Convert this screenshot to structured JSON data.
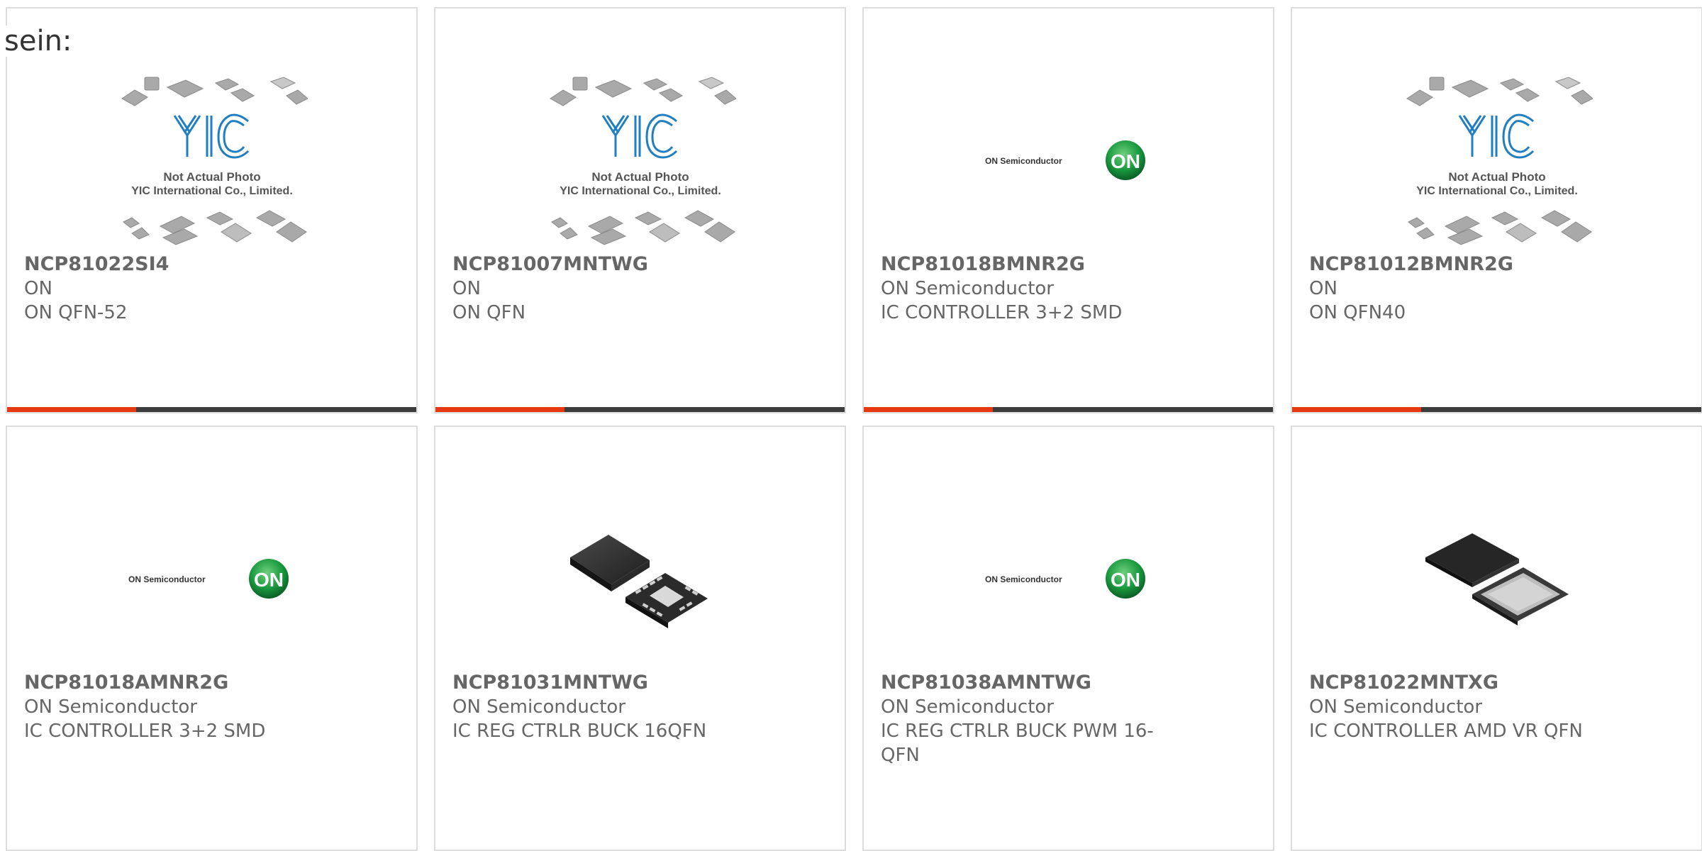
{
  "intro_text": "sein:",
  "placeholder_text": {
    "line1": "Not Actual Photo",
    "line2": "YIC International Co., Limited.",
    "logo": "YIC"
  },
  "on_logo": {
    "wordmark": "ON Semiconductor",
    "badge": "ON"
  },
  "colors": {
    "accent": "#e7390f",
    "bar": "#3b3b3b",
    "on_green": "#1a9a3f",
    "yic_blue": "#1f7fc0"
  },
  "products": [
    {
      "part": "NCP81022SI4",
      "manufacturer": "ON",
      "description": "ON QFN-52",
      "image": "yic-placeholder"
    },
    {
      "part": "NCP81007MNTWG",
      "manufacturer": "ON",
      "description": "ON QFN",
      "image": "yic-placeholder"
    },
    {
      "part": "NCP81018BMNR2G",
      "manufacturer": "ON Semiconductor",
      "description": "IC CONTROLLER 3+2 SMD",
      "image": "on-semi-logo"
    },
    {
      "part": "NCP81012BMNR2G",
      "manufacturer": "ON",
      "description": "ON QFN40",
      "image": "yic-placeholder"
    },
    {
      "part": "NCP81018AMNR2G",
      "manufacturer": "ON Semiconductor",
      "description": "IC CONTROLLER 3+2 SMD",
      "image": "on-semi-logo"
    },
    {
      "part": "NCP81031MNTWG",
      "manufacturer": "ON Semiconductor",
      "description": "IC REG CTRLR BUCK 16QFN",
      "image": "qfn16-chip"
    },
    {
      "part": "NCP81038AMNTWG",
      "manufacturer": "ON Semiconductor",
      "description": "IC REG CTRLR BUCK PWM 16-QFN",
      "image": "on-semi-logo"
    },
    {
      "part": "NCP81022MNTXG",
      "manufacturer": "ON Semiconductor",
      "description": "IC CONTROLLER AMD VR QFN",
      "image": "qfn52-chip"
    }
  ]
}
